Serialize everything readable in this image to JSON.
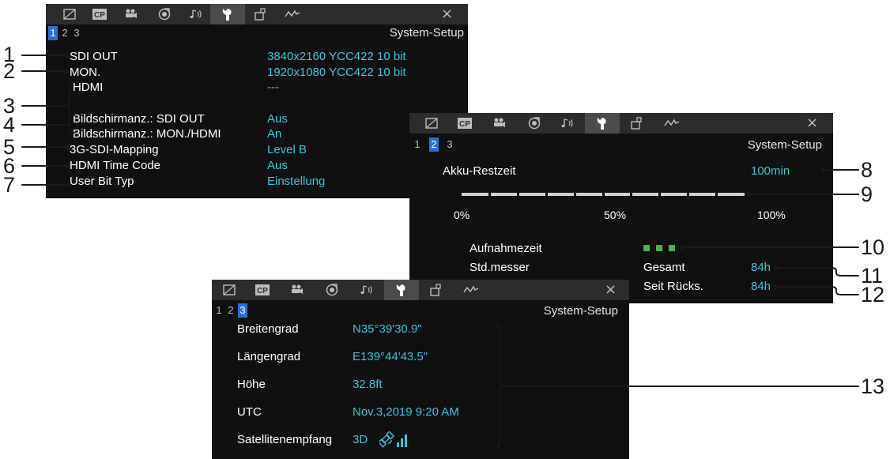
{
  "tab_icons": [
    "film-frame-icon",
    "cp-icon",
    "camera-icon",
    "record-dial-icon",
    "audio-icon",
    "wrench-icon",
    "assign-icon",
    "waveform-icon"
  ],
  "colors": {
    "panel_bg": "#101010",
    "menubar_bg": "#2c2c2c",
    "active_tab_bg": "#4b4b4b",
    "value_cyan": "#38c6d9",
    "page_highlight": "#2b6fd6",
    "green_indicator": "#4caf50",
    "callout_line": "#1a1a1a"
  },
  "panel1": {
    "pages": [
      "1",
      "2",
      "3"
    ],
    "selected_page": "1",
    "title": "System-Setup",
    "close": "×",
    "rows": [
      {
        "label": "SDI OUT",
        "value": "3840x2160 YCC422 10 bit"
      },
      {
        "label": "MON.",
        "value": "1920x1080 YCC422 10 bit"
      },
      {
        "label": "HDMI",
        "value": "---"
      },
      {
        "label": "Bildschirmanz.: SDI OUT",
        "value": "Aus"
      },
      {
        "label": "Bildschirmanz.: MON./HDMI",
        "value": "An"
      },
      {
        "label": "3G-SDI-Mapping",
        "value": "Level B"
      },
      {
        "label": "HDMI Time Code",
        "value": "Aus"
      },
      {
        "label": "User Bit Typ",
        "value": "Einstellung"
      }
    ]
  },
  "panel2": {
    "pages": [
      "1",
      "2",
      "3"
    ],
    "selected_page": "2",
    "title": "System-Setup",
    "close": "×",
    "battery_label": "Akku-Restzeit",
    "battery_value": "100min",
    "battery_level_percent": 100,
    "bar_ticks": [
      "0%",
      "50%",
      "100%"
    ],
    "record_time_label": "Aufnahmezeit",
    "record_time_level": 3,
    "hour_meter_label": "Std.messer",
    "total_label": "Gesamt",
    "total_value": "84h",
    "since_reset_label": "Seit Rücks.",
    "since_reset_value": "84h"
  },
  "panel3": {
    "pages": [
      "1",
      "2",
      "3"
    ],
    "selected_page": "3",
    "title": "System-Setup",
    "close": "×",
    "rows": [
      {
        "label": "Breitengrad",
        "value": "N35°39'30.9\""
      },
      {
        "label": "Längengrad",
        "value": "E139°44'43.5\""
      },
      {
        "label": "Höhe",
        "value": "32.8ft"
      },
      {
        "label": "UTC",
        "value": "Nov.3,2019 9:20 AM"
      },
      {
        "label": "Satellitenempfang",
        "value": "3D"
      }
    ],
    "satellite_icon": "satellite-signal-icon"
  },
  "callouts": [
    "1",
    "2",
    "3",
    "4",
    "5",
    "6",
    "7",
    "8",
    "9",
    "10",
    "11",
    "12",
    "13"
  ]
}
